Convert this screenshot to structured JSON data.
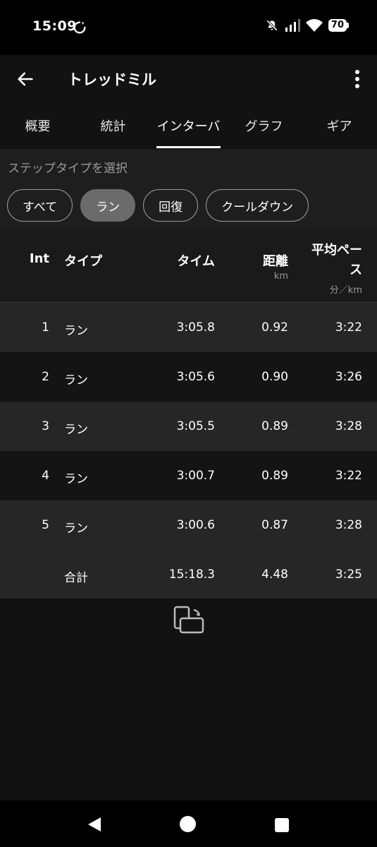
{
  "status": {
    "time": "15:09",
    "battery": "70"
  },
  "appbar": {
    "title": "トレッドミル"
  },
  "tabs": [
    {
      "label": "概要"
    },
    {
      "label": "統計"
    },
    {
      "label": "インターバル",
      "active": true
    },
    {
      "label": "グラフ"
    },
    {
      "label": "ギア"
    }
  ],
  "filter": {
    "label": "ステップタイプを選択",
    "chips": [
      "すべて",
      "ラン",
      "回復",
      "クールダウン"
    ],
    "selected": "ラン"
  },
  "table": {
    "headers": {
      "int": "Int",
      "type": "タイプ",
      "time": "タイム",
      "dist": "距離",
      "dist_unit": "km",
      "pace_line1": "平均ペー",
      "pace_line2": "ス",
      "pace_unit": "分／km"
    },
    "rows": [
      {
        "int": "1",
        "type": "ラン",
        "time": "3:05.8",
        "dist": "0.92",
        "pace": "3:22"
      },
      {
        "int": "2",
        "type": "ラン",
        "time": "3:05.6",
        "dist": "0.90",
        "pace": "3:26"
      },
      {
        "int": "3",
        "type": "ラン",
        "time": "3:05.5",
        "dist": "0.89",
        "pace": "3:28"
      },
      {
        "int": "4",
        "type": "ラン",
        "time": "3:00.7",
        "dist": "0.89",
        "pace": "3:22"
      },
      {
        "int": "5",
        "type": "ラン",
        "time": "3:00.6",
        "dist": "0.87",
        "pace": "3:28"
      }
    ],
    "total": {
      "label": "合計",
      "time": "15:18.3",
      "dist": "4.48",
      "pace": "3:25"
    }
  },
  "icons": {
    "back": "arrow-left-icon",
    "more": "more-vert-icon",
    "rotate": "screen-rotation-icon"
  }
}
